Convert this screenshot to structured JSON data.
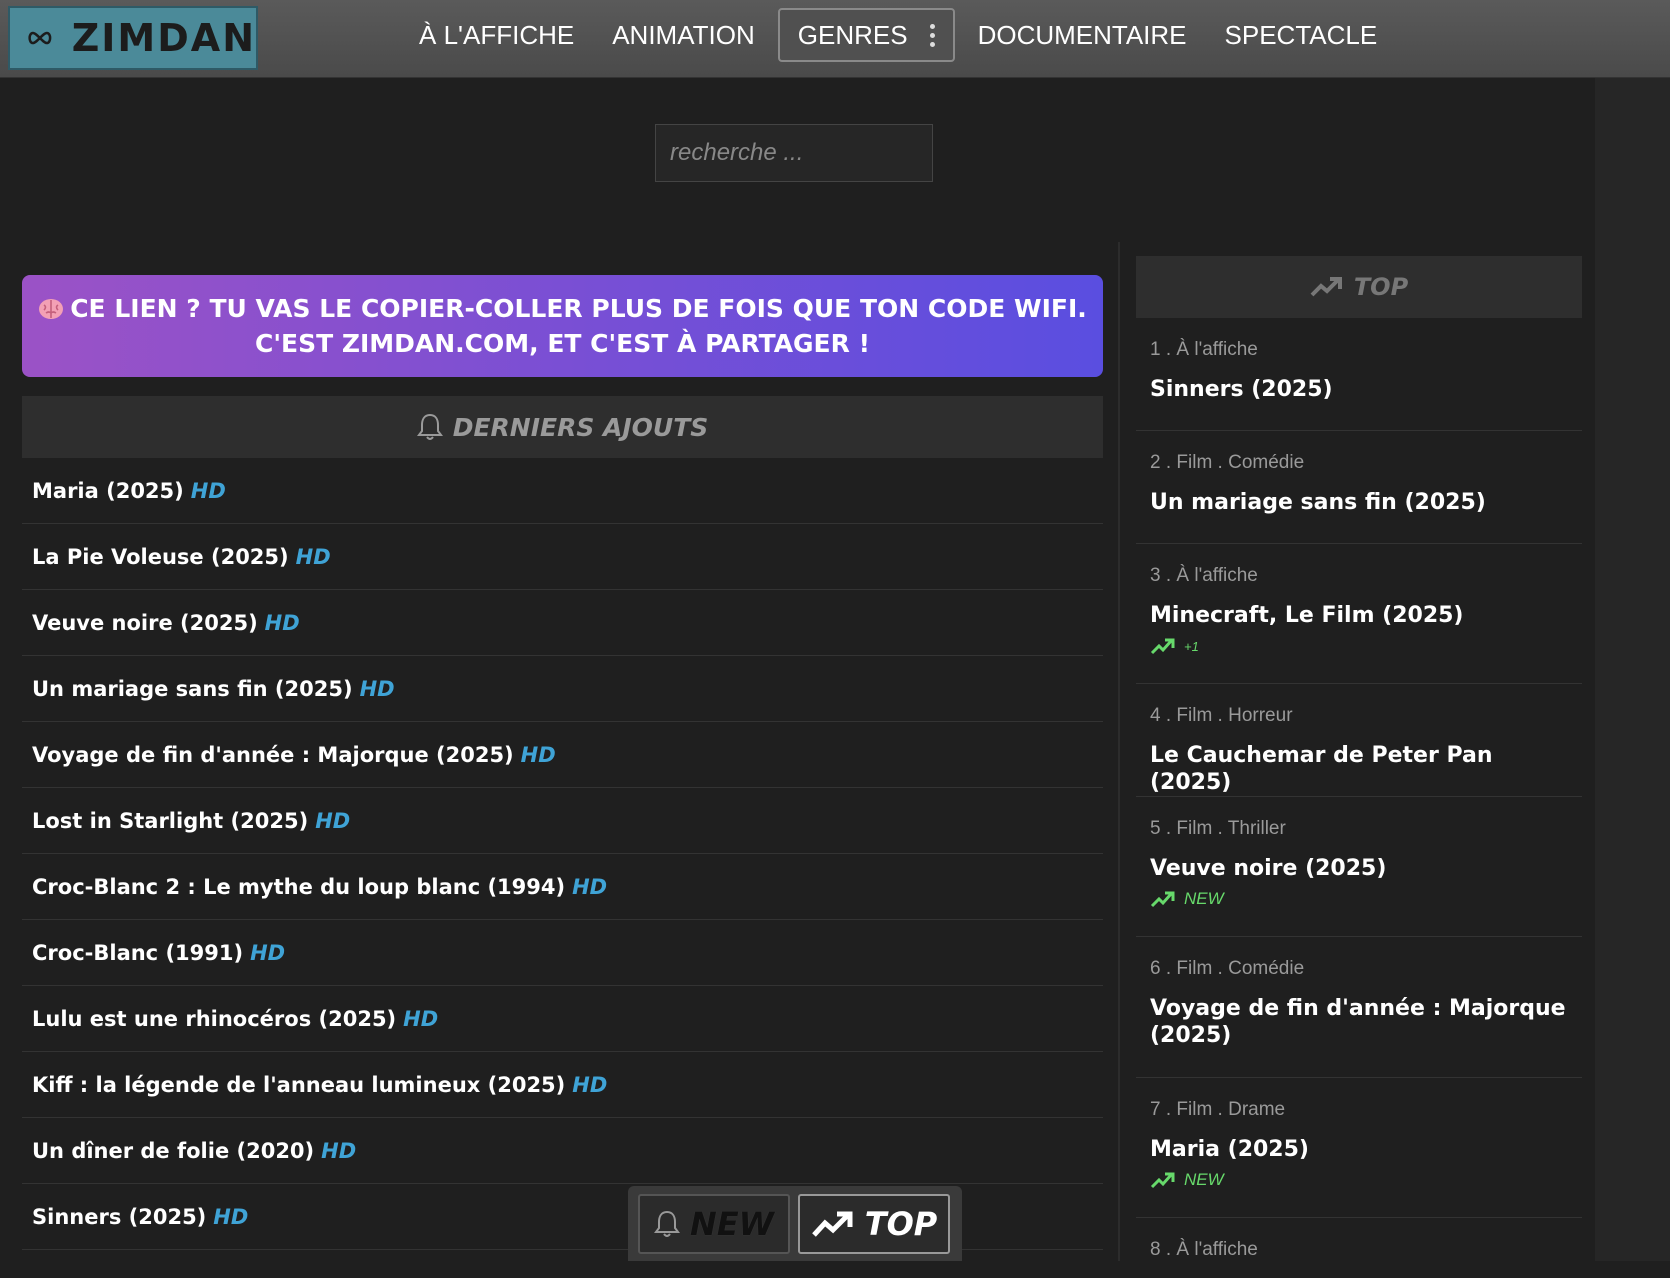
{
  "header": {
    "logo_text": "ZIMDAN",
    "nav": [
      {
        "label": "À L'AFFICHE"
      },
      {
        "label": "ANIMATION"
      },
      {
        "label": "GENRES"
      },
      {
        "label": "DOCUMENTAIRE"
      },
      {
        "label": "SPECTACLE"
      }
    ]
  },
  "search": {
    "placeholder": "recherche ..."
  },
  "banner": {
    "line1": "CE LIEN ? TU VAS LE COPIER-COLLER PLUS DE FOIS QUE TON CODE WIFI.",
    "line2": "C'EST ZIMDAN.COM, ET C'EST À PARTAGER !"
  },
  "latest": {
    "title": "DERNIERS AJOUTS",
    "items": [
      {
        "title": "Maria (2025)",
        "badge": "HD"
      },
      {
        "title": "La Pie Voleuse (2025)",
        "badge": "HD"
      },
      {
        "title": "Veuve noire (2025)",
        "badge": "HD"
      },
      {
        "title": "Un mariage sans fin (2025)",
        "badge": "HD"
      },
      {
        "title": "Voyage de fin d'année : Majorque (2025)",
        "badge": "HD"
      },
      {
        "title": "Lost in Starlight (2025)",
        "badge": "HD"
      },
      {
        "title": "Croc-Blanc 2 : Le mythe du loup blanc (1994)",
        "badge": "HD"
      },
      {
        "title": "Croc-Blanc (1991)",
        "badge": "HD"
      },
      {
        "title": "Lulu est une rhinocéros (2025)",
        "badge": "HD"
      },
      {
        "title": "Kiff : la légende de l'anneau lumineux (2025)",
        "badge": "HD"
      },
      {
        "title": "Un dîner de folie (2020)",
        "badge": "HD"
      },
      {
        "title": "Sinners (2025)",
        "badge": "HD"
      }
    ]
  },
  "top": {
    "title": "TOP",
    "items": [
      {
        "meta": "1 . À l'affiche",
        "title": "Sinners (2025)",
        "trend": ""
      },
      {
        "meta": "2 . Film . Comédie",
        "title": "Un mariage sans fin (2025)",
        "trend": ""
      },
      {
        "meta": "3 . À l'affiche",
        "title": "Minecraft, Le Film (2025)",
        "trend": "+1"
      },
      {
        "meta": "4 . Film . Horreur",
        "title": "Le Cauchemar de Peter Pan (2025)",
        "trend": ""
      },
      {
        "meta": "5 . Film . Thriller",
        "title": "Veuve noire (2025)",
        "trend": "NEW"
      },
      {
        "meta": "6 . Film . Comédie",
        "title": "Voyage de fin d'année : Majorque (2025)",
        "trend": ""
      },
      {
        "meta": "7 . Film . Drame",
        "title": "Maria (2025)",
        "trend": "NEW"
      },
      {
        "meta": "8 . À l'affiche",
        "title": "",
        "trend": ""
      }
    ]
  },
  "floatbar": {
    "new_label": "NEW",
    "top_label": "TOP"
  },
  "colors": {
    "accent_hd": "#3fa3d6",
    "trend_green": "#67d96b",
    "logo_bg": "#4b8a99"
  }
}
